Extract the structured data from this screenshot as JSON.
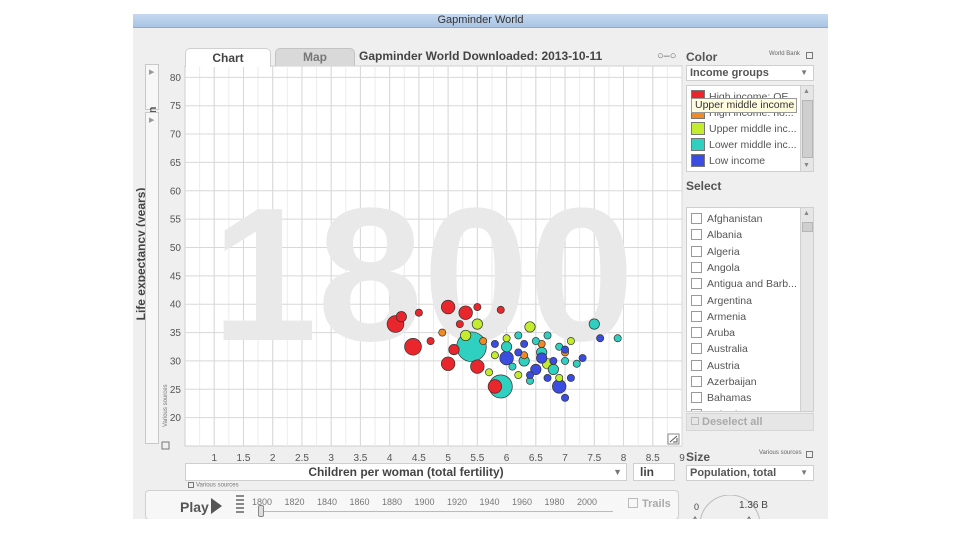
{
  "window": {
    "title": "Gapminder World"
  },
  "tabs": {
    "chart": "Chart",
    "map": "Map"
  },
  "page_title": "Gapminder World Downloaded: 2013-10-11",
  "y_axis": {
    "scale": "lin",
    "label": "Life expectancy (years)",
    "source": "Various sources"
  },
  "x_axis": {
    "label": "Children per woman (total fertility)",
    "scale": "lin",
    "source": "Various sources"
  },
  "big_year": "1800",
  "play": {
    "label": "Play",
    "years": [
      "1800",
      "1820",
      "1840",
      "1860",
      "1880",
      "1900",
      "1920",
      "1940",
      "1960",
      "1980",
      "2000"
    ],
    "trails_label": "Trails",
    "current_year": 1800
  },
  "color_panel": {
    "title": "Color",
    "source": "World Bank",
    "dropdown": "Income groups",
    "items": [
      {
        "label": "High income: OE...",
        "color": "#e8262b"
      },
      {
        "label": "High income: no...",
        "color": "#f08a24"
      },
      {
        "label": "Upper middle inc...",
        "color": "#c3ec2e"
      },
      {
        "label": "Lower middle inc...",
        "color": "#2fd0c0"
      },
      {
        "label": "Low income",
        "color": "#3a4de0"
      }
    ],
    "tooltip": "Upper middle income"
  },
  "select_panel": {
    "title": "Select",
    "items": [
      "Afghanistan",
      "Albania",
      "Algeria",
      "Angola",
      "Antigua and Barb...",
      "Argentina",
      "Armenia",
      "Aruba",
      "Australia",
      "Austria",
      "Azerbaijan",
      "Bahamas",
      "Bahrain"
    ],
    "deselect_label": "Deselect all"
  },
  "size_panel": {
    "title": "Size",
    "source": "Various sources",
    "dropdown": "Population, total",
    "min_label": "0",
    "max_label": "1.36 B"
  },
  "colors": {
    "high_oecd": "#e8262b",
    "high_non_oecd": "#f08a24",
    "upper_middle": "#c3ec2e",
    "lower_middle": "#2fd0c0",
    "low": "#3a4de0"
  },
  "chart_data": {
    "type": "scatter",
    "xlabel": "Children per woman (total fertility)",
    "ylabel": "Life expectancy (years)",
    "xlim": [
      0.5,
      9
    ],
    "ylim": [
      15,
      82
    ],
    "x_ticks": [
      "1",
      "1.5",
      "2",
      "2.5",
      "3",
      "3.5",
      "4",
      "4.5",
      "5",
      "5.5",
      "6",
      "6.5",
      "7",
      "7.5",
      "8",
      "8.5",
      "9"
    ],
    "y_ticks": [
      "20",
      "25",
      "30",
      "35",
      "40",
      "45",
      "50",
      "55",
      "60",
      "65",
      "70",
      "75",
      "80"
    ],
    "grid": true,
    "points": [
      {
        "x": 4.1,
        "y": 36.5,
        "s": 4,
        "g": "high_oecd"
      },
      {
        "x": 4.2,
        "y": 37.8,
        "s": 2,
        "g": "high_oecd"
      },
      {
        "x": 4.4,
        "y": 32.5,
        "s": 4,
        "g": "high_oecd"
      },
      {
        "x": 4.5,
        "y": 38.5,
        "s": 1,
        "g": "high_oecd"
      },
      {
        "x": 5.0,
        "y": 39.5,
        "s": 3,
        "g": "high_oecd"
      },
      {
        "x": 5.3,
        "y": 38.5,
        "s": 3,
        "g": "high_oecd"
      },
      {
        "x": 5.5,
        "y": 39.5,
        "s": 1,
        "g": "high_oecd"
      },
      {
        "x": 5.1,
        "y": 32.0,
        "s": 2,
        "g": "high_oecd"
      },
      {
        "x": 5.0,
        "y": 29.5,
        "s": 3,
        "g": "high_oecd"
      },
      {
        "x": 5.5,
        "y": 29.0,
        "s": 3,
        "g": "high_oecd"
      },
      {
        "x": 5.9,
        "y": 39.0,
        "s": 1,
        "g": "high_oecd"
      },
      {
        "x": 4.7,
        "y": 33.5,
        "s": 1,
        "g": "high_oecd"
      },
      {
        "x": 5.8,
        "y": 25.5,
        "s": 3,
        "g": "high_oecd"
      },
      {
        "x": 5.2,
        "y": 36.5,
        "s": 1,
        "g": "high_oecd"
      },
      {
        "x": 4.9,
        "y": 35.0,
        "s": 1,
        "g": "high_non_oecd"
      },
      {
        "x": 6.3,
        "y": 31.0,
        "s": 1,
        "g": "high_non_oecd"
      },
      {
        "x": 6.6,
        "y": 33.0,
        "s": 1,
        "g": "high_non_oecd"
      },
      {
        "x": 7.0,
        "y": 31.5,
        "s": 1,
        "g": "high_non_oecd"
      },
      {
        "x": 5.6,
        "y": 33.5,
        "s": 1,
        "g": "high_non_oecd"
      },
      {
        "x": 5.3,
        "y": 34.5,
        "s": 2,
        "g": "upper_middle"
      },
      {
        "x": 5.5,
        "y": 36.5,
        "s": 2,
        "g": "upper_middle"
      },
      {
        "x": 6.0,
        "y": 34.0,
        "s": 1,
        "g": "upper_middle"
      },
      {
        "x": 6.4,
        "y": 36.0,
        "s": 2,
        "g": "upper_middle"
      },
      {
        "x": 6.7,
        "y": 29.5,
        "s": 2,
        "g": "upper_middle"
      },
      {
        "x": 5.8,
        "y": 31.0,
        "s": 1,
        "g": "upper_middle"
      },
      {
        "x": 7.1,
        "y": 33.5,
        "s": 1,
        "g": "upper_middle"
      },
      {
        "x": 6.2,
        "y": 27.5,
        "s": 1,
        "g": "upper_middle"
      },
      {
        "x": 6.9,
        "y": 27.0,
        "s": 1,
        "g": "upper_middle"
      },
      {
        "x": 5.7,
        "y": 28.0,
        "s": 1,
        "g": "upper_middle"
      },
      {
        "x": 5.4,
        "y": 32.5,
        "s": 8,
        "g": "lower_middle"
      },
      {
        "x": 5.9,
        "y": 25.5,
        "s": 6,
        "g": "lower_middle"
      },
      {
        "x": 7.5,
        "y": 36.5,
        "s": 2,
        "g": "lower_middle"
      },
      {
        "x": 6.0,
        "y": 32.5,
        "s": 2,
        "g": "lower_middle"
      },
      {
        "x": 6.3,
        "y": 30.0,
        "s": 2,
        "g": "lower_middle"
      },
      {
        "x": 6.6,
        "y": 31.5,
        "s": 2,
        "g": "lower_middle"
      },
      {
        "x": 6.2,
        "y": 34.5,
        "s": 1,
        "g": "lower_middle"
      },
      {
        "x": 6.8,
        "y": 28.5,
        "s": 2,
        "g": "lower_middle"
      },
      {
        "x": 7.0,
        "y": 30.0,
        "s": 1,
        "g": "lower_middle"
      },
      {
        "x": 6.5,
        "y": 33.5,
        "s": 1,
        "g": "lower_middle"
      },
      {
        "x": 6.9,
        "y": 32.5,
        "s": 1,
        "g": "lower_middle"
      },
      {
        "x": 6.1,
        "y": 29.0,
        "s": 1,
        "g": "lower_middle"
      },
      {
        "x": 6.4,
        "y": 26.5,
        "s": 1,
        "g": "lower_middle"
      },
      {
        "x": 7.2,
        "y": 29.5,
        "s": 1,
        "g": "lower_middle"
      },
      {
        "x": 7.9,
        "y": 34.0,
        "s": 1,
        "g": "lower_middle"
      },
      {
        "x": 6.7,
        "y": 34.5,
        "s": 1,
        "g": "lower_middle"
      },
      {
        "x": 6.0,
        "y": 30.5,
        "s": 3,
        "g": "low"
      },
      {
        "x": 6.5,
        "y": 28.5,
        "s": 2,
        "g": "low"
      },
      {
        "x": 6.9,
        "y": 25.5,
        "s": 3,
        "g": "low"
      },
      {
        "x": 6.2,
        "y": 31.5,
        "s": 1,
        "g": "low"
      },
      {
        "x": 6.6,
        "y": 30.5,
        "s": 2,
        "g": "low"
      },
      {
        "x": 7.0,
        "y": 32.0,
        "s": 1,
        "g": "low"
      },
      {
        "x": 5.8,
        "y": 33.0,
        "s": 1,
        "g": "low"
      },
      {
        "x": 6.3,
        "y": 33.0,
        "s": 1,
        "g": "low"
      },
      {
        "x": 6.8,
        "y": 30.0,
        "s": 1,
        "g": "low"
      },
      {
        "x": 7.1,
        "y": 27.0,
        "s": 1,
        "g": "low"
      },
      {
        "x": 7.3,
        "y": 30.5,
        "s": 1,
        "g": "low"
      },
      {
        "x": 7.6,
        "y": 34.0,
        "s": 1,
        "g": "low"
      },
      {
        "x": 6.4,
        "y": 27.5,
        "s": 1,
        "g": "low"
      },
      {
        "x": 7.0,
        "y": 23.5,
        "s": 1,
        "g": "low"
      },
      {
        "x": 6.7,
        "y": 27.0,
        "s": 1,
        "g": "low"
      }
    ]
  }
}
